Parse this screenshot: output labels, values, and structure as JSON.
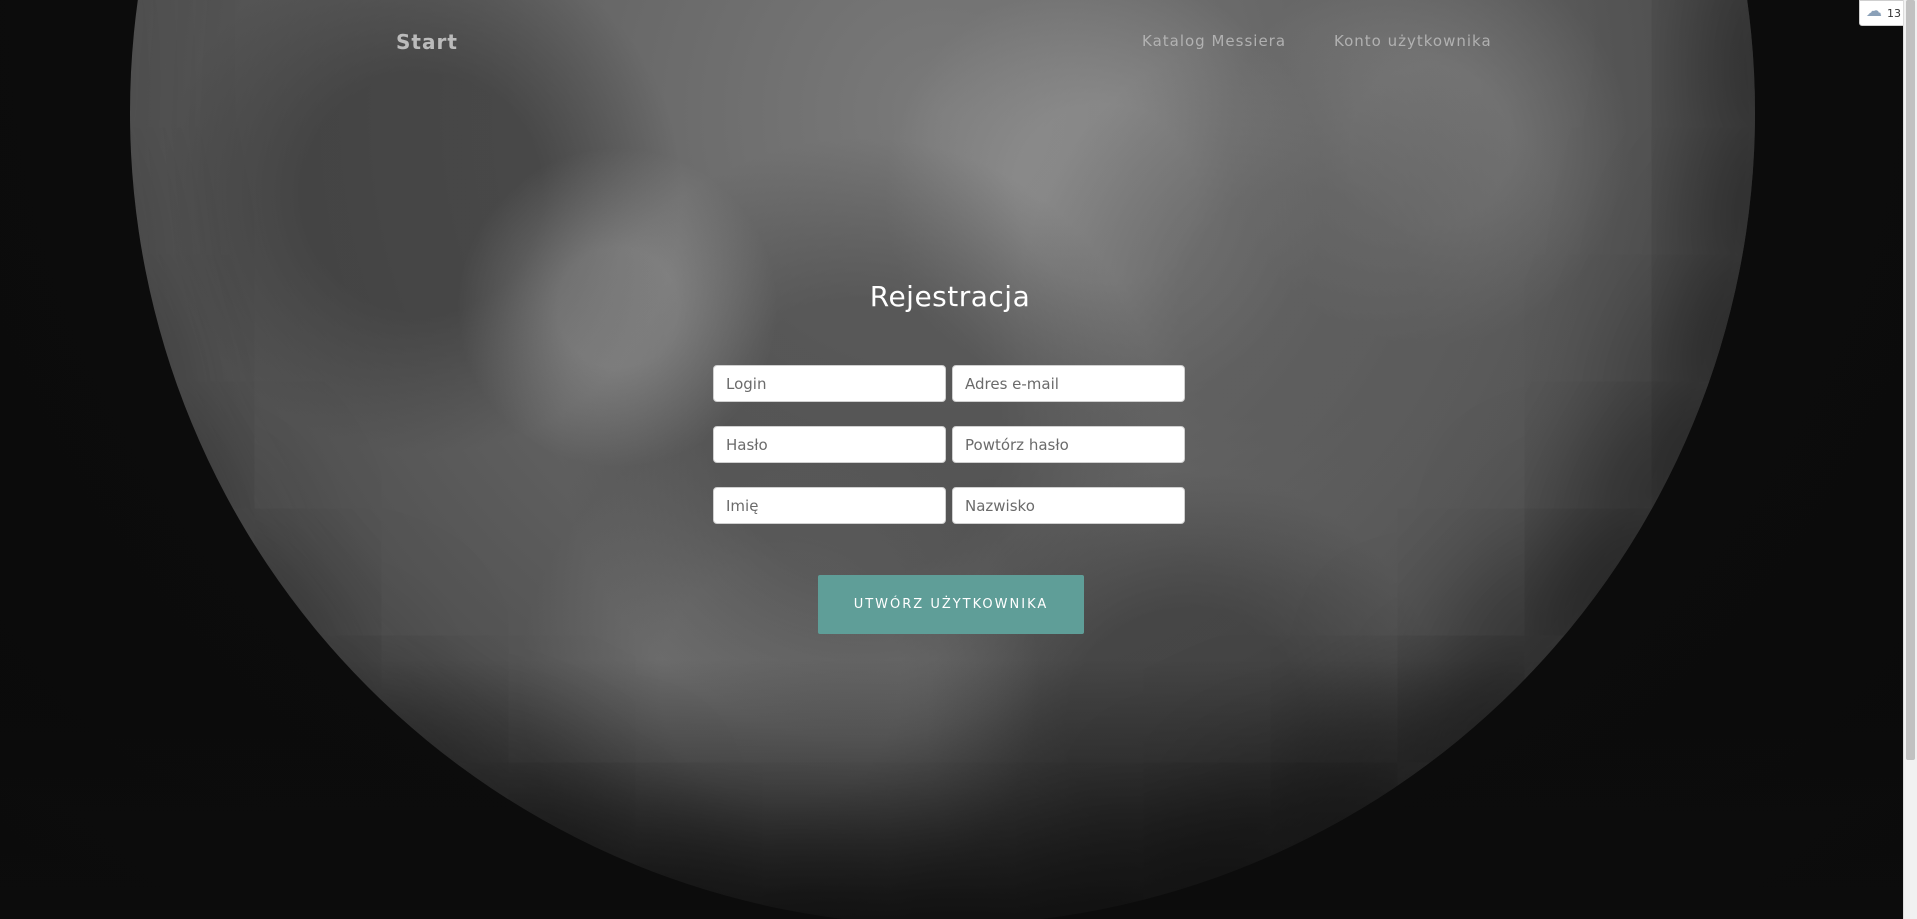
{
  "nav": {
    "brand": "Start",
    "links": [
      {
        "label": "Katalog Messiera"
      },
      {
        "label": "Konto użytkownika"
      }
    ]
  },
  "form": {
    "title": "Rejestracja",
    "fields": {
      "login": {
        "placeholder": "Login",
        "value": ""
      },
      "email": {
        "placeholder": "Adres e-mail",
        "value": ""
      },
      "password": {
        "placeholder": "Hasło",
        "value": ""
      },
      "password_repeat": {
        "placeholder": "Powtórz hasło",
        "value": ""
      },
      "first_name": {
        "placeholder": "Imię",
        "value": ""
      },
      "last_name": {
        "placeholder": "Nazwisko",
        "value": ""
      }
    },
    "submit_label": "UTWÓRZ UŻYTKOWNIKA"
  },
  "widget": {
    "icon": "weather-cloud-icon",
    "value": "13"
  },
  "colors": {
    "accent_button": "#5f9e98",
    "background": "#0b0b0b"
  }
}
